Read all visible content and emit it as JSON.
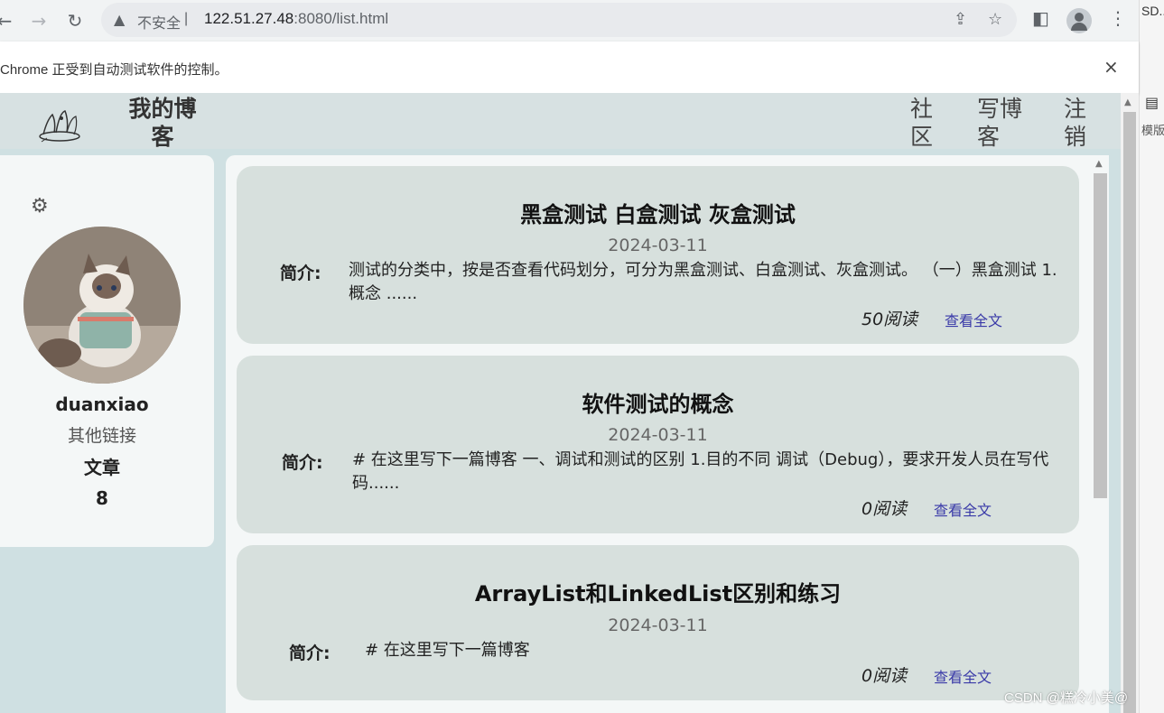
{
  "browser": {
    "security_label": "不安全",
    "url_host": "122.51.27.48",
    "url_path": ":8080/list.html",
    "side_top_text": "SD...",
    "side_mid_text": "模版"
  },
  "infobar": {
    "text": "Chrome 正受到自动测试软件的控制。",
    "close": "×"
  },
  "navbar": {
    "site_title": "我的博客",
    "links": [
      {
        "label": "社区"
      },
      {
        "label": "写博客"
      },
      {
        "label": "注销"
      }
    ]
  },
  "profile": {
    "username": "duanxiao",
    "other_links": "其他链接",
    "articles_label": "文章",
    "articles_count": "8"
  },
  "blogs": [
    {
      "title": "黑盒测试 白盒测试 灰盒测试",
      "date": "2024-03-11",
      "label": "简介:",
      "desc": "测试的分类中，按是否查看代码划分，可分为黑盒测试、白盒测试、灰盒测试。 （一）黑盒测试 1.概念 ......",
      "reads": "50阅读",
      "link": "查看全文"
    },
    {
      "title": "软件测试的概念",
      "date": "2024-03-11",
      "label": "简介:",
      "desc": "# 在这里写下一篇博客 一、调试和测试的区别 1.目的不同 调试（Debug），要求开发人员在写代码......",
      "reads": "0阅读",
      "link": "查看全文"
    },
    {
      "title": "ArrayList和LinkedList区别和练习",
      "date": "2024-03-11",
      "label": "简介:",
      "desc": "# 在这里写下一篇博客",
      "reads": "0阅读",
      "link": "查看全文"
    }
  ],
  "watermark": "CSDN @糕冷小美@"
}
